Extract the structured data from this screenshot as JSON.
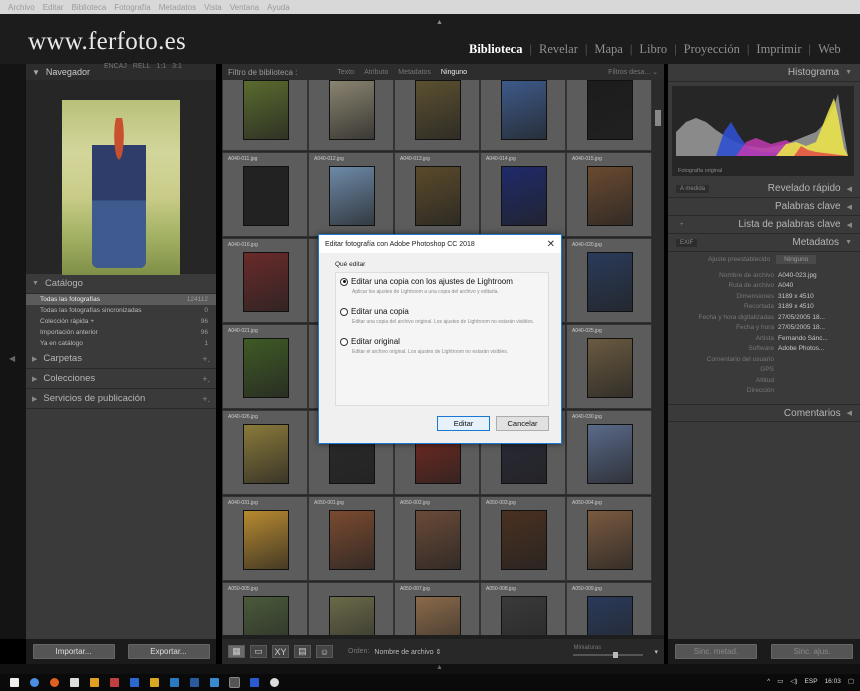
{
  "menubar": {
    "items": [
      "Archivo",
      "Editar",
      "Biblioteca",
      "Fotografía",
      "Metadatos",
      "Vista",
      "Ventana",
      "Ayuda"
    ]
  },
  "header": {
    "site_title": "www.ferfoto.es",
    "modules": [
      "Biblioteca",
      "Revelar",
      "Mapa",
      "Libro",
      "Proyección",
      "Imprimir",
      "Web"
    ],
    "active_module": "Biblioteca"
  },
  "navigator": {
    "title": "Navegador",
    "options": [
      "ENCAJ",
      "RELL",
      "1:1",
      "3:1"
    ]
  },
  "catalog": {
    "title": "Catálogo",
    "rows": [
      {
        "label": "Todas las fotografías",
        "count": "124112",
        "selected": true
      },
      {
        "label": "Todas las fotografías sincronizadas",
        "count": "0"
      },
      {
        "label": "Colección rápida +",
        "count": "96"
      },
      {
        "label": "Importación anterior",
        "count": "96"
      },
      {
        "label": "Ya en catálogo",
        "count": "1"
      }
    ]
  },
  "left_sections": [
    {
      "label": "Carpetas"
    },
    {
      "label": "Colecciones"
    },
    {
      "label": "Servicios de publicación"
    }
  ],
  "left_buttons": {
    "import": "Importar...",
    "export": "Exportar..."
  },
  "filter_bar": {
    "title": "Filtro de biblioteca :",
    "options": [
      "Texto",
      "Atributo",
      "Metadatos",
      "Ninguno"
    ],
    "active": "Ninguno",
    "right": "Filtros desa... ⌄"
  },
  "grid": {
    "cells": [
      {
        "label": "",
        "color": "#5a6b2e"
      },
      {
        "label": "",
        "color": "#8a8470"
      },
      {
        "label": "",
        "color": "#5b5030"
      },
      {
        "label": "",
        "color": "#3d5a8a"
      },
      {
        "label": "",
        "color": "#1c1c1c"
      },
      {
        "label": "A040-011.jpg",
        "color": "#222"
      },
      {
        "label": "A040-012.jpg",
        "color": "#6d8aa8"
      },
      {
        "label": "A040-013.jpg",
        "color": "#5a4a2a"
      },
      {
        "label": "A040-014.jpg",
        "color": "#1f2a6a"
      },
      {
        "label": "A040-015.jpg",
        "color": "#6a4a30"
      },
      {
        "label": "A040-016.jpg",
        "color": "#6a2a2a"
      },
      {
        "label": "",
        "color": "#555"
      },
      {
        "label": "",
        "color": "#555"
      },
      {
        "label": "",
        "color": "#555"
      },
      {
        "label": "A040-020.jpg",
        "color": "#2a3b5a"
      },
      {
        "label": "A040-021.jpg",
        "color": "#3f5a25"
      },
      {
        "label": "",
        "color": "#555"
      },
      {
        "label": "",
        "color": "#555"
      },
      {
        "label": "",
        "color": "#555"
      },
      {
        "label": "A040-025.jpg",
        "color": "#6a5a40"
      },
      {
        "label": "A040-026.jpg",
        "color": "#8a7a3a"
      },
      {
        "label": "",
        "color": "#2a2a2a"
      },
      {
        "label": "",
        "color": "#7a2a20"
      },
      {
        "label": "",
        "color": "#2a2a3a"
      },
      {
        "label": "A040-030.jpg",
        "color": "#5a6a8a"
      },
      {
        "label": "A040-031.jpg",
        "color": "#b88a30"
      },
      {
        "label": "A050-001.jpg",
        "color": "#7a4a30"
      },
      {
        "label": "A050-002.jpg",
        "color": "#6a4a38"
      },
      {
        "label": "A050-003.jpg",
        "color": "#4a3020"
      },
      {
        "label": "A050-004.jpg",
        "color": "#7a5a40"
      },
      {
        "label": "A050-005.jpg",
        "color": "#4a5a3a"
      },
      {
        "label": "",
        "color": "#6a6a4a"
      },
      {
        "label": "A050-007.jpg",
        "color": "#8a6a4a"
      },
      {
        "label": "A050-008.jpg",
        "color": "#3a3a3a"
      },
      {
        "label": "A050-009.jpg",
        "color": "#2a3a5a"
      }
    ]
  },
  "toolbar": {
    "sort_label": "Orden:",
    "sort_value": "Nombre de archivo ⇕",
    "thumb_label": "Miniaturas"
  },
  "right_panel": {
    "histogram": {
      "title": "Histograma",
      "caption": "Fotografía original"
    },
    "quick_develop": {
      "title": "Revelado rápido",
      "tag": "A medida"
    },
    "keywords": {
      "title": "Palabras clave"
    },
    "keyword_list": {
      "title": "Lista de palabras clave"
    },
    "metadata": {
      "title": "Metadatos",
      "tag": "EXIF",
      "preset_label": "Ajuste preestablecido",
      "preset_value": "Ninguno",
      "rows": [
        {
          "key": "Nombre de archivo",
          "value": "A040-023.jpg"
        },
        {
          "key": "Ruta de archivo",
          "value": "A040"
        },
        {
          "key": "Dimensiones",
          "value": "3189 x 4510"
        },
        {
          "key": "Recortada",
          "value": "3189 x 4510"
        },
        {
          "key": "Fecha y hora digitalizadas",
          "value": "27/05/2005 18..."
        },
        {
          "key": "Fecha y hora",
          "value": "27/05/2005 18..."
        },
        {
          "key": "Artista",
          "value": "Fernando Sánc..."
        },
        {
          "key": "Software",
          "value": "Adobe Photos..."
        },
        {
          "key": "Comentario del usuario",
          "value": ""
        },
        {
          "key": "GPS",
          "value": ""
        },
        {
          "key": "Altitud",
          "value": ""
        },
        {
          "key": "Dirección",
          "value": ""
        }
      ]
    },
    "comments": {
      "title": "Comentarios"
    }
  },
  "right_buttons": {
    "sync_metadata": "Sinc. metad.",
    "sync_settings": "Sinc. ajus."
  },
  "dialog": {
    "title": "Editar fotografía con Adobe Photoshop CC 2018",
    "group_label": "Qué editar",
    "options": [
      {
        "label": "Editar una copia con los ajustes de Lightroom",
        "desc": "Aplicar los ajustes de Lightroom a una copia del archivo y editarla.",
        "selected": true
      },
      {
        "label": "Editar una copia",
        "desc": "Editar una copia del archivo original. Los ajustes de Lightroom no estarán visibles.",
        "selected": false
      },
      {
        "label": "Editar original",
        "desc": "Editar el archivo original. Los ajustes de Lightroom no estarán visibles.",
        "selected": false
      }
    ],
    "edit_button": "Editar",
    "cancel_button": "Cancelar"
  },
  "taskbar": {
    "lang": "ESP",
    "time": "16:03"
  }
}
